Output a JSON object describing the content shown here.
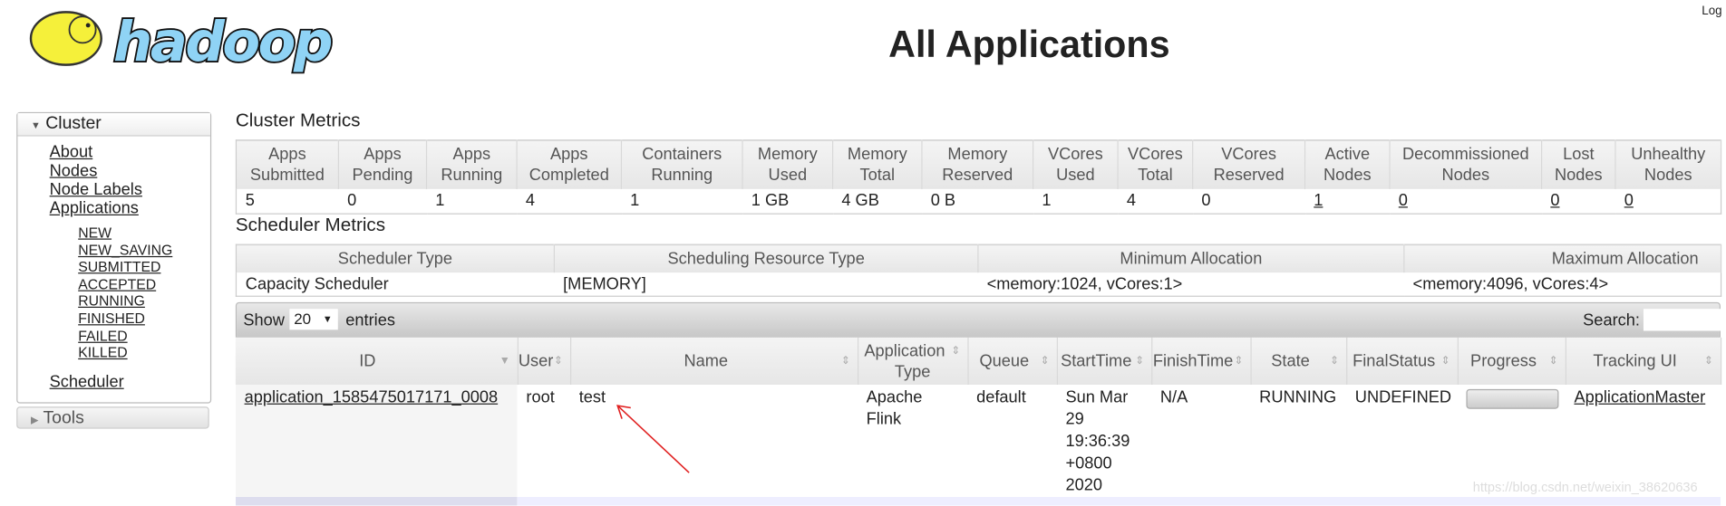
{
  "header": {
    "title": "All Applications",
    "login": "Log",
    "logo_text": "hadoop"
  },
  "sidebar": {
    "cluster_label": "Cluster",
    "links": [
      "About",
      "Nodes",
      "Node Labels",
      "Applications"
    ],
    "states": [
      "NEW",
      "NEW_SAVING",
      "SUBMITTED",
      "ACCEPTED",
      "RUNNING",
      "FINISHED",
      "FAILED",
      "KILLED"
    ],
    "scheduler": "Scheduler",
    "tools_label": "Tools"
  },
  "cluster_metrics": {
    "title": "Cluster Metrics",
    "headers": [
      [
        "Apps",
        "Submitted"
      ],
      [
        "Apps",
        "Pending"
      ],
      [
        "Apps",
        "Running"
      ],
      [
        "Apps",
        "Completed"
      ],
      [
        "Containers",
        "Running"
      ],
      [
        "Memory",
        "Used"
      ],
      [
        "Memory",
        "Total"
      ],
      [
        "Memory",
        "Reserved"
      ],
      [
        "VCores",
        "Used"
      ],
      [
        "VCores",
        "Total"
      ],
      [
        "VCores",
        "Reserved"
      ],
      [
        "Active",
        "Nodes"
      ],
      [
        "Decommissioned",
        "Nodes"
      ],
      [
        "Lost",
        "Nodes"
      ],
      [
        "Unhealthy",
        "Nodes"
      ]
    ],
    "values": [
      "5",
      "0",
      "1",
      "4",
      "1",
      "1 GB",
      "4 GB",
      "0 B",
      "1",
      "4",
      "0",
      "1",
      "0",
      "0",
      "0"
    ]
  },
  "scheduler_metrics": {
    "title": "Scheduler Metrics",
    "headers": [
      "Scheduler Type",
      "Scheduling Resource Type",
      "Minimum Allocation",
      "Maximum Allocation"
    ],
    "values": [
      "Capacity Scheduler",
      "[MEMORY]",
      "<memory:1024, vCores:1>",
      "<memory:4096, vCores:4>"
    ]
  },
  "apps": {
    "show": "Show",
    "entries_value": "20",
    "entries": "entries",
    "search_label": "Search:",
    "search_value": "",
    "headers": [
      "ID",
      "User",
      "Name",
      "Application Type",
      "Queue",
      "StartTime",
      "FinishTime",
      "State",
      "FinalStatus",
      "Progress",
      "Tracking UI"
    ],
    "rows": [
      {
        "id": "application_1585475017171_0008",
        "user": "root",
        "name": "test",
        "type": "Apache Flink",
        "queue": "default",
        "start": "Sun Mar 29 19:36:39 +0800 2020",
        "finish": "N/A",
        "state": "RUNNING",
        "final": "UNDEFINED",
        "progress": 0,
        "tracking": "ApplicationMaster"
      }
    ]
  },
  "watermark": "https://blog.csdn.net/weixin_38620636",
  "colors": {
    "logo_blue": "#8fd3f5",
    "elephant": "#f5f03a",
    "annotation_arrow": "#e02020"
  }
}
